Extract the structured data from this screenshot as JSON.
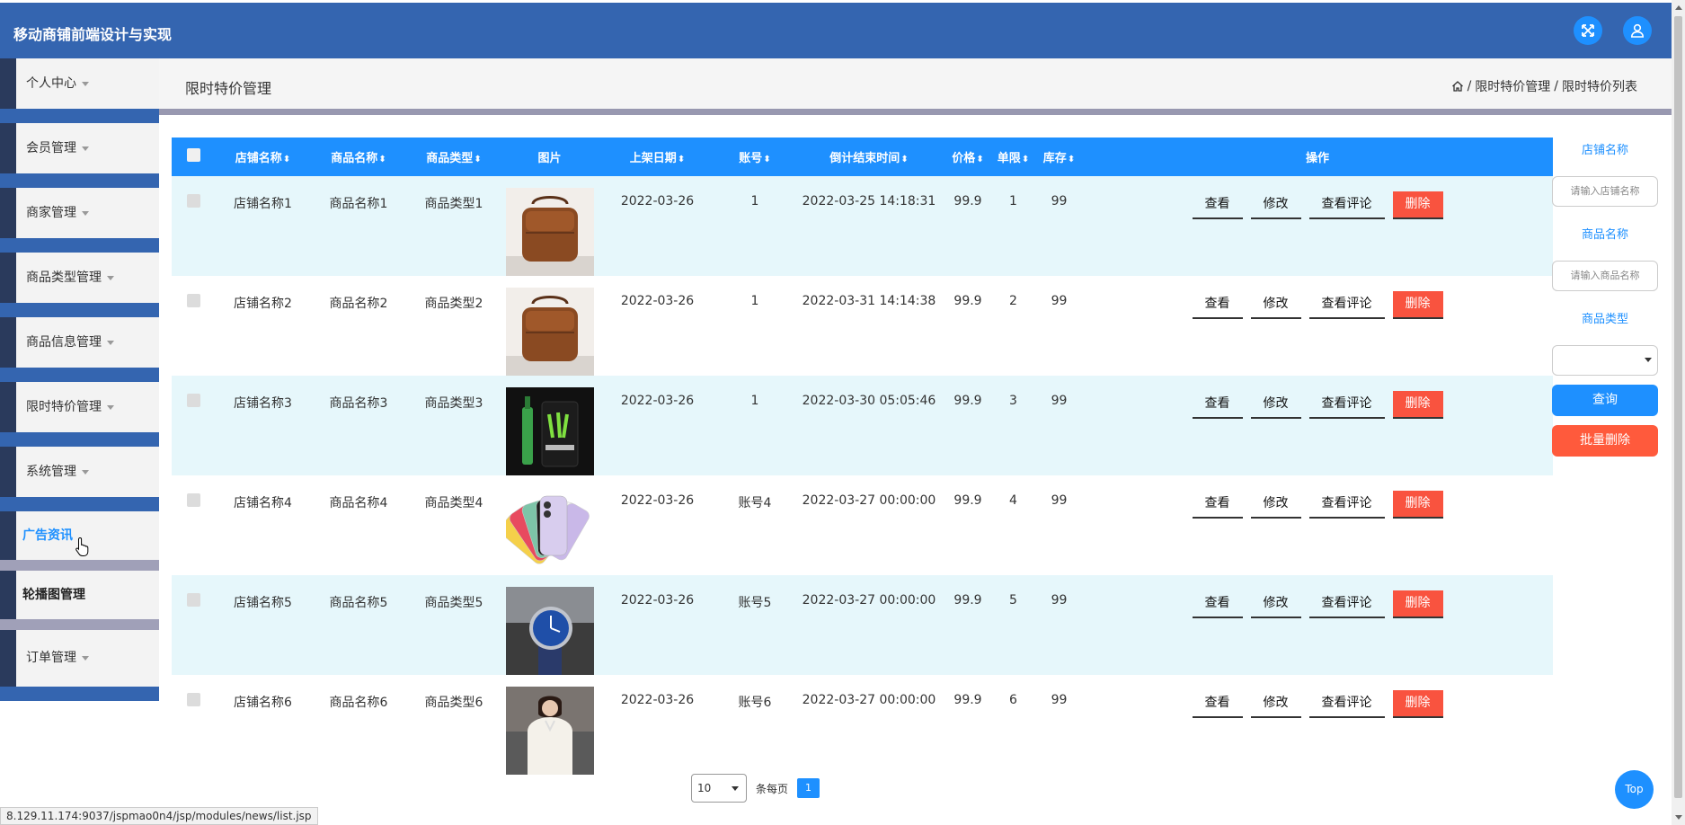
{
  "app": {
    "title": "移动商铺前端设计与实现"
  },
  "header_icons": [
    "fullscreen-icon",
    "user-icon"
  ],
  "sidebar": {
    "items": [
      {
        "label": "个人中心",
        "caret": true,
        "state": "normal"
      },
      {
        "label": "会员管理",
        "caret": true,
        "state": "normal"
      },
      {
        "label": "商家管理",
        "caret": true,
        "state": "normal"
      },
      {
        "label": "商品类型管理",
        "caret": true,
        "state": "normal"
      },
      {
        "label": "商品信息管理",
        "caret": true,
        "state": "normal"
      },
      {
        "label": "限时特价管理",
        "caret": true,
        "state": "normal"
      },
      {
        "label": "系统管理",
        "caret": true,
        "state": "normal"
      },
      {
        "label": "广告资讯",
        "caret": false,
        "state": "active"
      },
      {
        "label": "轮播图管理",
        "caret": false,
        "state": "plain"
      },
      {
        "label": "订单管理",
        "caret": true,
        "state": "normal"
      }
    ]
  },
  "page": {
    "title": "限时特价管理",
    "breadcrumb": [
      "限时特价管理",
      "限时特价列表"
    ],
    "breadcrumb_sep": "/"
  },
  "table": {
    "columns": [
      {
        "label": "",
        "type": "checkbox"
      },
      {
        "label": "店铺名称",
        "sortable": true
      },
      {
        "label": "商品名称",
        "sortable": true
      },
      {
        "label": "商品类型",
        "sortable": true
      },
      {
        "label": "图片",
        "sortable": false
      },
      {
        "label": "上架日期",
        "sortable": true
      },
      {
        "label": "账号",
        "sortable": true
      },
      {
        "label": "倒计结束时间",
        "sortable": true
      },
      {
        "label": "价格",
        "sortable": true
      },
      {
        "label": "单限",
        "sortable": true
      },
      {
        "label": "库存",
        "sortable": true
      },
      {
        "label": "操作",
        "sortable": false
      }
    ],
    "sort_glyph": "⬍",
    "action_labels": {
      "view": "查看",
      "edit": "修改",
      "comments": "查看评论",
      "delete": "删除"
    },
    "rows": [
      {
        "shop": "店铺名称1",
        "name": "商品名称1",
        "type": "商品类型1",
        "image": "brown-leather-bag",
        "date": "2022-03-26",
        "account": "1",
        "end_time": "2022-03-25 14:18:31",
        "price": "99.9",
        "limit": "1",
        "stock": "99"
      },
      {
        "shop": "店铺名称2",
        "name": "商品名称2",
        "type": "商品类型2",
        "image": "brown-leather-bag",
        "date": "2022-03-26",
        "account": "1",
        "end_time": "2022-03-31 14:14:38",
        "price": "99.9",
        "limit": "2",
        "stock": "99"
      },
      {
        "shop": "店铺名称3",
        "name": "商品名称3",
        "type": "商品类型3",
        "image": "energy-drink-can",
        "date": "2022-03-26",
        "account": "1",
        "end_time": "2022-03-30 05:05:46",
        "price": "99.9",
        "limit": "3",
        "stock": "99"
      },
      {
        "shop": "店铺名称4",
        "name": "商品名称4",
        "type": "商品类型4",
        "image": "phone-colors",
        "date": "2022-03-26",
        "account": "账号4",
        "end_time": "2022-03-27 00:00:00",
        "price": "99.9",
        "limit": "4",
        "stock": "99"
      },
      {
        "shop": "店铺名称5",
        "name": "商品名称5",
        "type": "商品类型5",
        "image": "wrist-watch",
        "date": "2022-03-26",
        "account": "账号5",
        "end_time": "2022-03-27 00:00:00",
        "price": "99.9",
        "limit": "5",
        "stock": "99"
      },
      {
        "shop": "店铺名称6",
        "name": "商品名称6",
        "type": "商品类型6",
        "image": "white-blouse",
        "date": "2022-03-26",
        "account": "账号6",
        "end_time": "2022-03-27 00:00:00",
        "price": "99.9",
        "limit": "6",
        "stock": "99"
      }
    ]
  },
  "pagination": {
    "page_size": "10",
    "per_page_label": "条每页",
    "current_page": "1"
  },
  "search": {
    "shop_label": "店铺名称",
    "shop_placeholder": "请输入店铺名称",
    "name_label": "商品名称",
    "name_placeholder": "请输入商品名称",
    "type_label": "商品类型",
    "type_value": "",
    "query_button": "查询",
    "batch_delete_button": "批量删除"
  },
  "top_button": "Top",
  "status_url": "8.129.11.174:9037/jspmao0n4/jsp/modules/news/list.jsp",
  "colors": {
    "primary": "#1e90ff",
    "header": "#3465b0",
    "danger": "#f9533f",
    "row_stripe": "#e6f7fb"
  }
}
